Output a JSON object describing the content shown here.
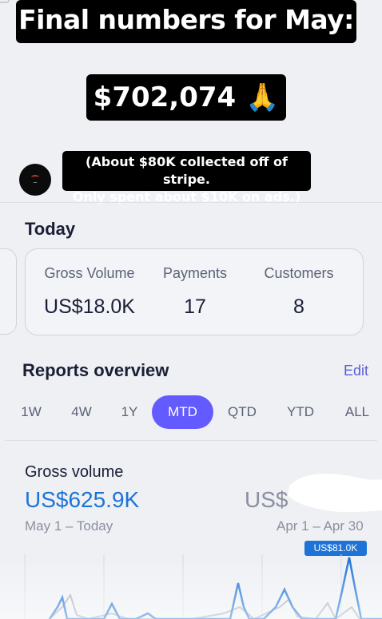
{
  "overlay": {
    "title": "Final numbers for May:",
    "total": "$702,074 🙏",
    "note_line1": "(About $80K collected off of stripe.",
    "note_line2": "Only spent about $10K on ads.)"
  },
  "today": {
    "title": "Today",
    "metrics": [
      {
        "label": "Gross Volume",
        "value": "US$18.0K"
      },
      {
        "label": "Payments",
        "value": "17"
      },
      {
        "label": "Customers",
        "value": "8"
      }
    ]
  },
  "reports": {
    "title": "Reports overview",
    "edit_label": "Edit",
    "periods": [
      "1W",
      "4W",
      "1Y",
      "MTD",
      "QTD",
      "YTD",
      "ALL"
    ],
    "active_period": "MTD"
  },
  "gross_volume": {
    "title": "Gross volume",
    "value": "US$625.9K",
    "range": "May 1 – Today",
    "prev_value": "US$",
    "prev_range": "Apr 1 – Apr 30",
    "peak_badge": "US$81.0K"
  },
  "colors": {
    "accent": "#635bff",
    "link": "#1e74d6",
    "current_series": "#1e74d6",
    "previous_series": "#a9adb8"
  },
  "chart_data": {
    "type": "line",
    "series": [],
    "note": "Sparkline partially visible; values not labeled except peak"
  }
}
